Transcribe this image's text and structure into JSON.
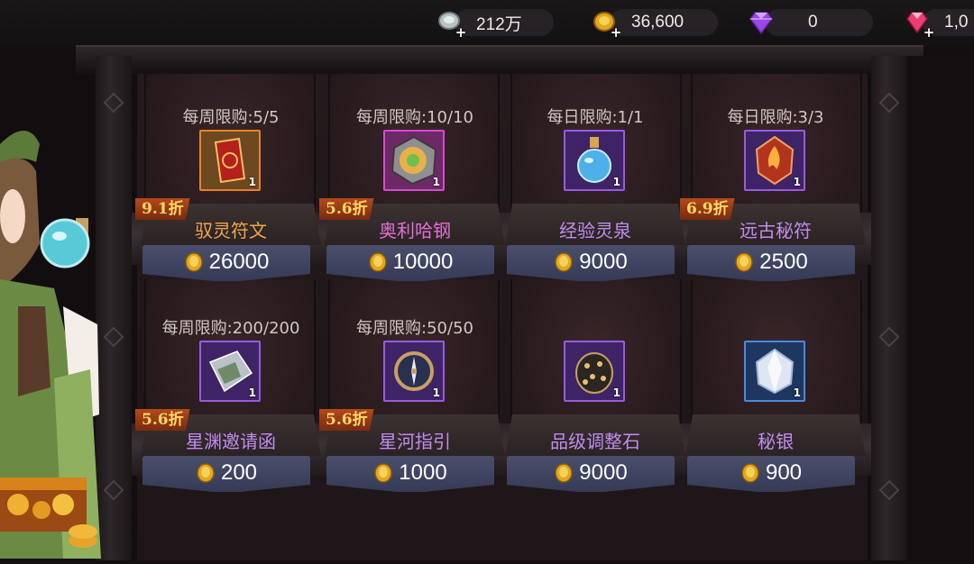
{
  "currencies": [
    {
      "name": "silver",
      "icon": "silver-coin-icon",
      "value": "212万"
    },
    {
      "name": "gold",
      "icon": "gold-coin-icon",
      "value": "36,600"
    },
    {
      "name": "purple_diamond",
      "icon": "purple-diamond-icon",
      "value": "0"
    },
    {
      "name": "pink_diamond",
      "icon": "pink-diamond-icon",
      "value": "1,0"
    }
  ],
  "items": [
    {
      "limit": "每周限购:5/5",
      "name": "驭灵符文",
      "price": "26000",
      "discount": "9.1折",
      "qty": "1",
      "name_color": "orange",
      "icon": "red-card-icon",
      "frame": "orange"
    },
    {
      "limit": "每周限购:10/10",
      "name": "奥利哈钢",
      "price": "10000",
      "discount": "5.6折",
      "qty": "1",
      "name_color": "purple",
      "icon": "orichalcum-ore-icon",
      "frame": "pink"
    },
    {
      "limit": "每日限购:1/1",
      "name": "经验灵泉",
      "price": "9000",
      "discount": "",
      "qty": "1",
      "name_color": "purple",
      "icon": "potion-flask-icon",
      "frame": "purple"
    },
    {
      "limit": "每日限购:3/3",
      "name": "远古秘符",
      "price": "2500",
      "discount": "6.9折",
      "qty": "1",
      "name_color": "purple",
      "icon": "fire-crest-icon",
      "frame": "purple"
    },
    {
      "limit": "每周限购:200/200",
      "name": "星渊邀请函",
      "price": "200",
      "discount": "5.6折",
      "qty": "1",
      "name_color": "purple",
      "icon": "crystal-envelope-icon",
      "frame": "purple"
    },
    {
      "limit": "每周限购:50/50",
      "name": "星河指引",
      "price": "1000",
      "discount": "5.6折",
      "qty": "1",
      "name_color": "purple",
      "icon": "star-compass-icon",
      "frame": "purple"
    },
    {
      "limit": "",
      "name": "品级调整石",
      "price": "9000",
      "discount": "",
      "qty": "1",
      "name_color": "purple",
      "icon": "adjust-stone-icon",
      "frame": "purple"
    },
    {
      "limit": "",
      "name": "秘银",
      "price": "900",
      "discount": "",
      "qty": "1",
      "name_color": "purple",
      "icon": "mithril-gem-icon",
      "frame": "blue"
    }
  ]
}
